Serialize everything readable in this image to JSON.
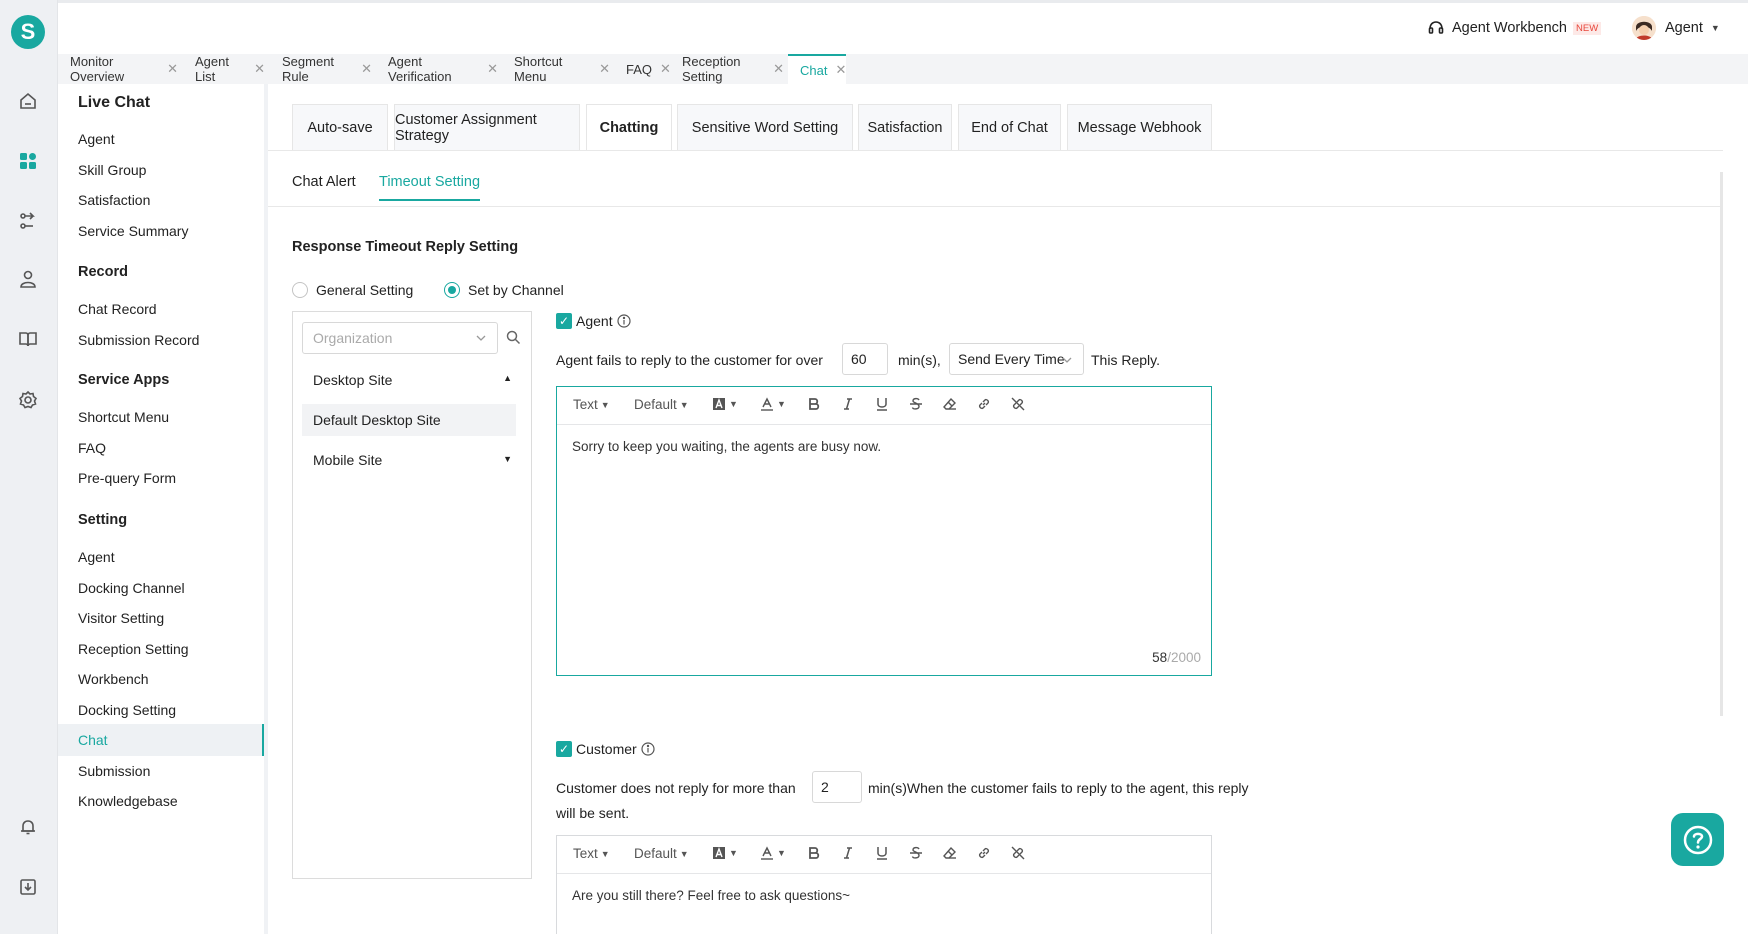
{
  "app": {
    "logo_letter": "S",
    "workbench_label": "Agent Workbench",
    "workbench_badge": "NEW",
    "user_label": "Agent"
  },
  "rail_icons": [
    "home-icon",
    "dashboard-icon",
    "route-icon",
    "user-icon",
    "book-icon",
    "settings-icon",
    "bell-icon",
    "download-icon"
  ],
  "page_tabs": [
    {
      "label": "Monitor Overview"
    },
    {
      "label": "Agent List"
    },
    {
      "label": "Segment Rule"
    },
    {
      "label": "Agent Verification"
    },
    {
      "label": "Shortcut Menu"
    },
    {
      "label": "FAQ"
    },
    {
      "label": "Reception Setting"
    },
    {
      "label": "Chat",
      "active": true
    }
  ],
  "sidebar": {
    "groups": [
      {
        "title": "Live Chat",
        "items": [
          "Agent",
          "Skill Group",
          "Satisfaction",
          "Service Summary"
        ]
      },
      {
        "title": "Record",
        "items": [
          "Chat Record",
          "Submission Record"
        ]
      },
      {
        "title": "Service Apps",
        "items": [
          "Shortcut Menu",
          "FAQ",
          "Pre-query Form"
        ]
      },
      {
        "title": "Setting",
        "items": [
          "Agent",
          "Docking Channel",
          "Visitor Setting",
          "Reception Setting",
          "Workbench",
          "Docking Setting",
          "Chat",
          "Submission",
          "Knowledgebase"
        ]
      }
    ],
    "active_item": "Chat"
  },
  "cards": [
    "Auto-save",
    "Customer Assignment Strategy",
    "Chatting",
    "Sensitive Word Setting",
    "Satisfaction",
    "End of Chat",
    "Message Webhook"
  ],
  "active_card": "Chatting",
  "subtabs": [
    "Chat Alert",
    "Timeout Setting"
  ],
  "active_subtab": "Timeout Setting",
  "section_title": "Response Timeout Reply Setting",
  "radios": {
    "general": "General Setting",
    "channel": "Set by Channel",
    "selected": "Set by Channel"
  },
  "channel_panel": {
    "org_placeholder": "Organization",
    "items": [
      {
        "label": "Desktop Site",
        "expanded": true
      },
      {
        "label": "Default Desktop Site",
        "selected": true
      },
      {
        "label": "Mobile Site",
        "expanded": false
      }
    ]
  },
  "agent_block": {
    "checkbox_label": "Agent",
    "checked": true,
    "prefix": "Agent fails to reply to the customer for over",
    "minutes": "60",
    "unit": "min(s),",
    "frequency": "Send Every Time",
    "suffix": "This Reply.",
    "message": "Sorry to keep you waiting, the agents are busy now.",
    "count": "58",
    "max": "/2000"
  },
  "customer_block": {
    "checkbox_label": "Customer",
    "checked": true,
    "prefix": "Customer does not reply for more than",
    "minutes": "2",
    "suffix_line1": "min(s)When the customer fails to reply to the agent, this reply",
    "suffix_line2": "will be sent.",
    "message": "Are you still there? Feel free to ask questions~"
  },
  "toolbar": {
    "text_label": "Text",
    "size_label": "Default"
  },
  "colors": {
    "accent": "#19a8a0",
    "badge": "#e8473c"
  }
}
